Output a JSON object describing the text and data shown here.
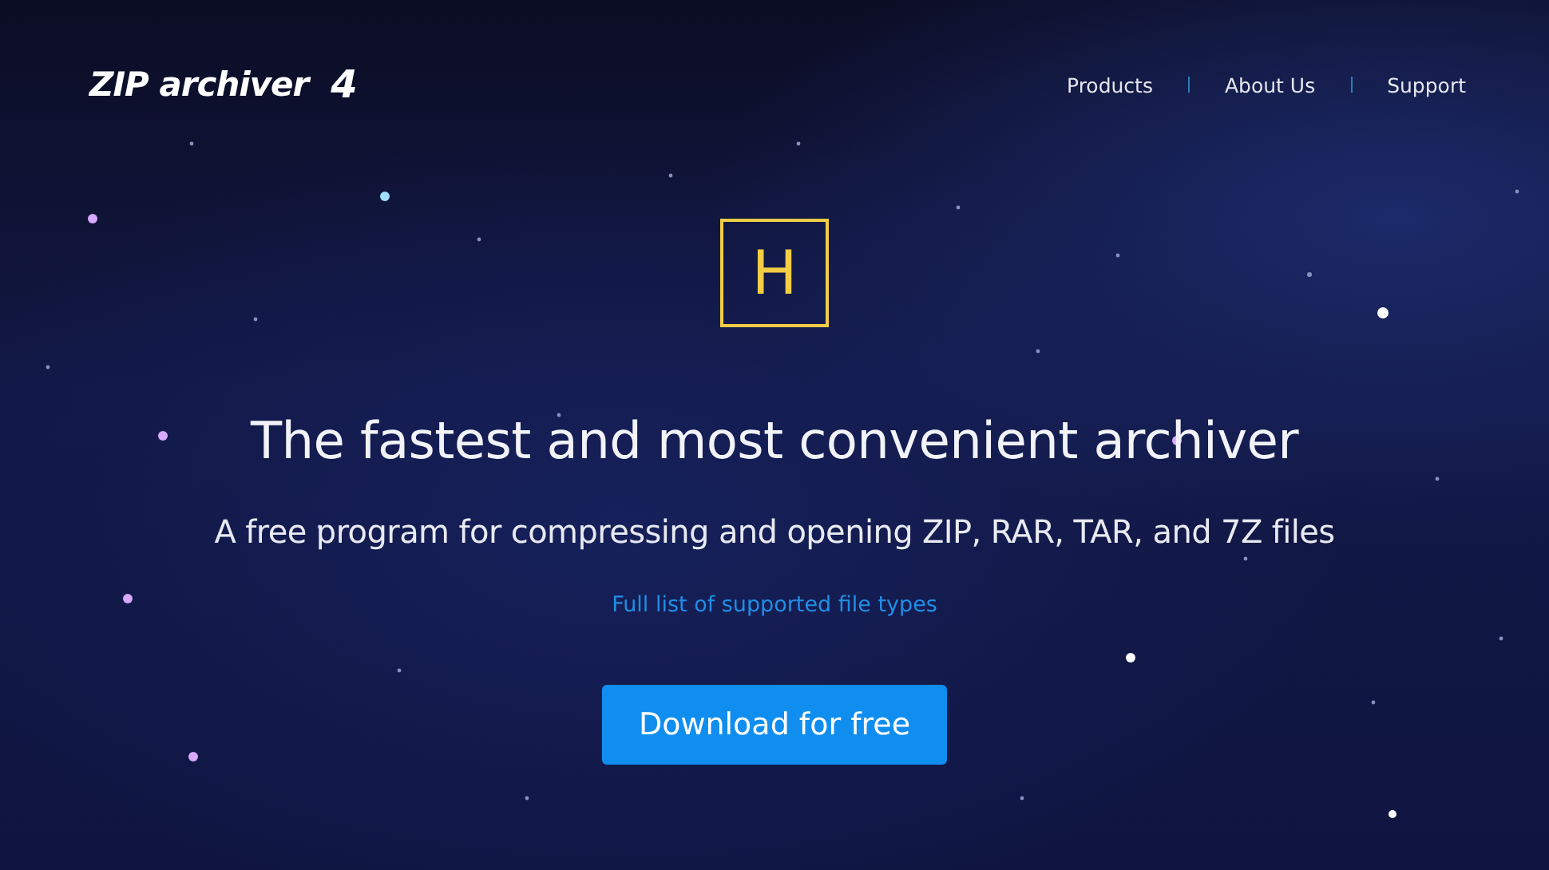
{
  "header": {
    "logo": {
      "name": "ZIP archiver",
      "version": "4"
    },
    "nav": [
      {
        "label": "Products"
      },
      {
        "label": "About Us"
      },
      {
        "label": "Support"
      }
    ]
  },
  "hero": {
    "icon_letter": "H",
    "title": "The fastest and most convenient archiver",
    "subtitle": "A free program for compressing and opening ZIP, RAR, TAR, and 7Z files",
    "link": "Full list of supported file types",
    "button": "Download for free"
  }
}
